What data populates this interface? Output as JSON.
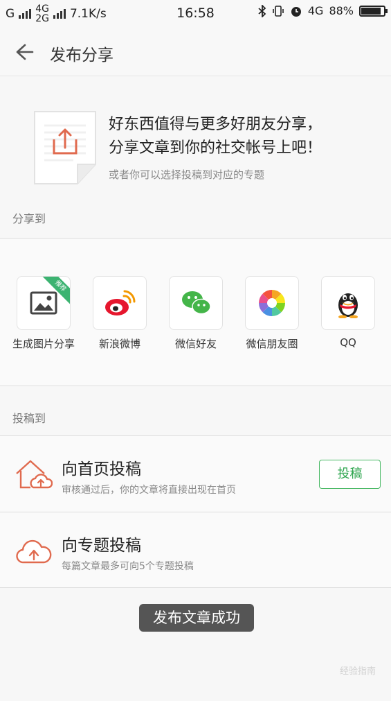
{
  "status_bar": {
    "carrier1": "G",
    "carrier2_top": "4G",
    "carrier2_bottom": "2G",
    "speed": "7.1K/s",
    "time": "16:58",
    "network": "4G",
    "battery": "88%",
    "battery_level": 0.88
  },
  "header": {
    "title": "发布分享",
    "back_icon": "back-arrow-icon"
  },
  "intro": {
    "line1": "好东西值得与更多好朋友分享，",
    "line2": "分享文章到你的社交帐号上吧！",
    "sub": "或者你可以选择投稿到对应的专题"
  },
  "share": {
    "section_label": "分享到",
    "items": [
      {
        "label": "生成图片分享",
        "badge": "推荐",
        "icon": "image-icon"
      },
      {
        "label": "新浪微博",
        "icon": "weibo-icon"
      },
      {
        "label": "微信好友",
        "icon": "wechat-icon"
      },
      {
        "label": "微信朋友圈",
        "icon": "moments-icon"
      },
      {
        "label": "QQ",
        "icon": "qq-icon"
      }
    ]
  },
  "contribute": {
    "section_label": "投稿到",
    "home": {
      "title": "向首页投稿",
      "desc": "审核通过后，你的文章将直接出现在首页",
      "button": "投稿",
      "icon": "home-upload-icon"
    },
    "topic": {
      "title": "向专题投稿",
      "desc": "每篇文章最多可向5个专题投稿",
      "icon": "cloud-upload-icon"
    }
  },
  "toast": "发布文章成功",
  "watermark": "经验指南",
  "colors": {
    "accent_green": "#48b864",
    "icon_orange": "#e06a4e",
    "toast_bg": "#555555"
  }
}
